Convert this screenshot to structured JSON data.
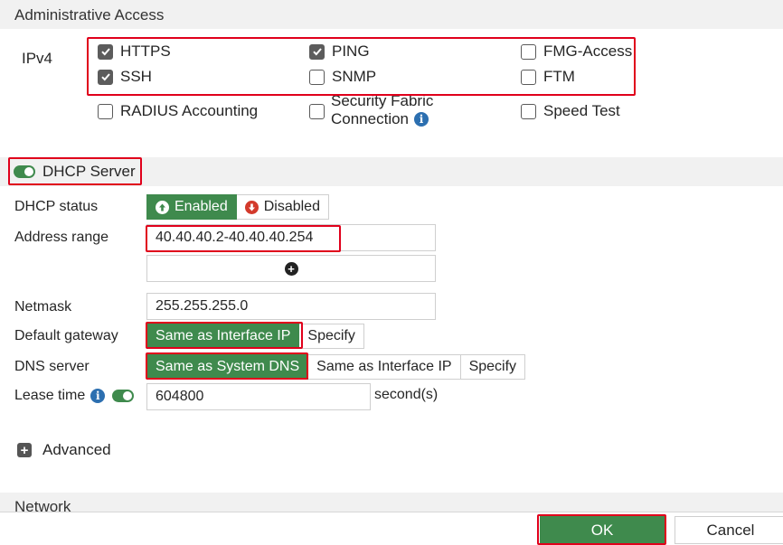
{
  "admin_access": {
    "title": "Administrative Access",
    "ipv4_label": "IPv4",
    "options": [
      {
        "label": "HTTPS",
        "checked": true
      },
      {
        "label": "PING",
        "checked": true
      },
      {
        "label": "FMG-Access",
        "checked": false
      },
      {
        "label": "SSH",
        "checked": true
      },
      {
        "label": "SNMP",
        "checked": false
      },
      {
        "label": "FTM",
        "checked": false
      },
      {
        "label": "RADIUS Accounting",
        "checked": false
      },
      {
        "label_line1": "Security Fabric",
        "label_line2": "Connection",
        "checked": false
      },
      {
        "label": "Speed Test",
        "checked": false
      }
    ]
  },
  "dhcp": {
    "title": "DHCP Server",
    "enabled_toggle": true,
    "status_label": "DHCP status",
    "status_enabled": "Enabled",
    "status_disabled": "Disabled",
    "address_range_label": "Address range",
    "address_range_value": "40.40.40.2-40.40.40.254",
    "netmask_label": "Netmask",
    "netmask_value": "255.255.255.0",
    "gateway_label": "Default gateway",
    "gateway_options": [
      "Same as Interface IP",
      "Specify"
    ],
    "dns_label": "DNS server",
    "dns_options": [
      "Same as System DNS",
      "Same as Interface IP",
      "Specify"
    ],
    "lease_label": "Lease time",
    "lease_value": "604800",
    "lease_unit": "second(s)",
    "advanced_label": "Advanced"
  },
  "network": {
    "title": "Network"
  },
  "footer": {
    "ok_label": "OK",
    "cancel_label": "Cancel"
  },
  "colors": {
    "accent_green": "#3f8a4d",
    "highlight_red": "#e0001b",
    "info_blue": "#2c6fb0",
    "disabled_red": "#d33a2c"
  }
}
